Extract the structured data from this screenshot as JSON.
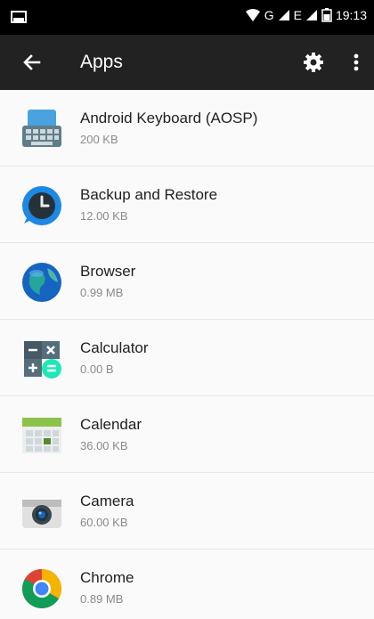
{
  "status_bar": {
    "network_label": "G",
    "network_label_2": "E",
    "time": "19:13"
  },
  "app_bar": {
    "title": "Apps"
  },
  "apps": [
    {
      "name": "Android Keyboard (AOSP)",
      "size": "200 KB",
      "icon": "keyboard-icon"
    },
    {
      "name": "Backup and Restore",
      "size": "12.00 KB",
      "icon": "backup-restore-icon"
    },
    {
      "name": "Browser",
      "size": "0.99 MB",
      "icon": "browser-globe-icon"
    },
    {
      "name": "Calculator",
      "size": "0.00 B",
      "icon": "calculator-icon"
    },
    {
      "name": "Calendar",
      "size": "36.00 KB",
      "icon": "calendar-icon"
    },
    {
      "name": "Camera",
      "size": "60.00 KB",
      "icon": "camera-icon"
    },
    {
      "name": "Chrome",
      "size": "0.89 MB",
      "icon": "chrome-icon"
    }
  ]
}
